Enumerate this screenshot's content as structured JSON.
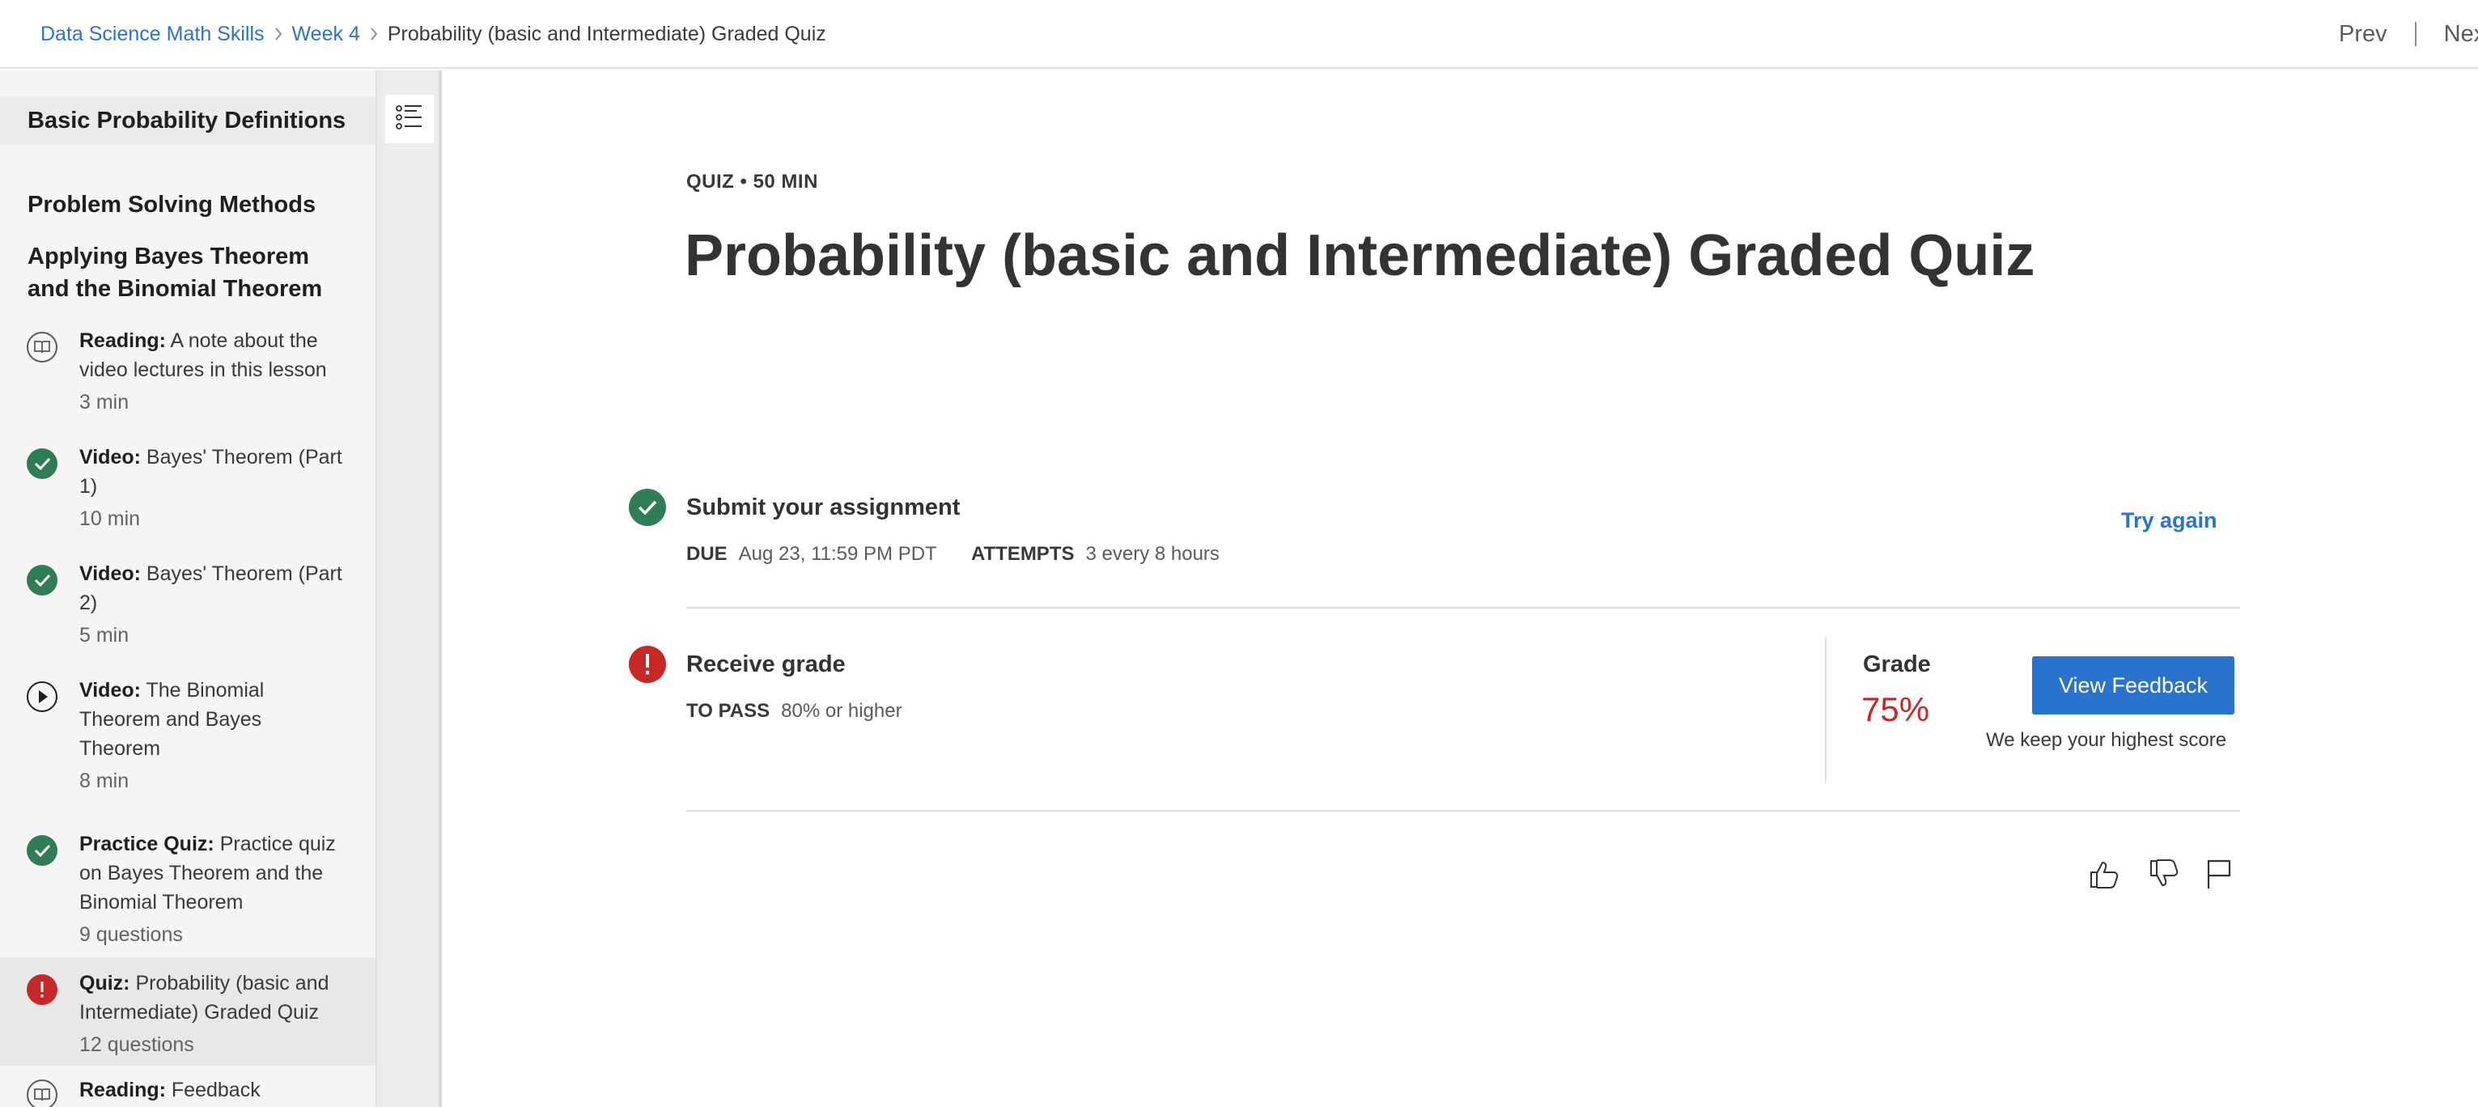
{
  "breadcrumb": {
    "items": [
      "Data Science Math Skills",
      "Week 4"
    ],
    "current": "Probability (basic and Intermediate) Graded Quiz"
  },
  "nav": {
    "prev": "Prev",
    "next": "Next"
  },
  "sidebar": {
    "sections": [
      "Basic Probability Definitions",
      "Problem Solving Methods",
      "Applying Bayes Theorem and the Binomial Theorem"
    ],
    "items": [
      {
        "type": "Reading:",
        "title": "A note about the video lectures in this lesson",
        "meta": "3 min",
        "status": "book-icon"
      },
      {
        "type": "Video:",
        "title": "Bayes' Theorem (Part 1)",
        "meta": "10 min",
        "status": "check-circle-icon"
      },
      {
        "type": "Video:",
        "title": "Bayes' Theorem (Part 2)",
        "meta": "5 min",
        "status": "check-circle-icon"
      },
      {
        "type": "Video:",
        "title": "The Binomial Theorem and Bayes Theorem",
        "meta": "8 min",
        "status": "play-circle-icon"
      },
      {
        "type": "Practice Quiz:",
        "title": "Practice quiz on Bayes Theorem and the Binomial Theorem",
        "meta": "9 questions",
        "status": "check-circle-icon"
      },
      {
        "type": "Quiz:",
        "title": "Probability (basic and Intermediate) Graded Quiz",
        "meta": "12 questions",
        "status": "alert-circle-icon"
      },
      {
        "type": "Reading:",
        "title": "Feedback",
        "meta": "",
        "status": "book-icon"
      }
    ]
  },
  "main": {
    "kicker": "QUIZ • 50 MIN",
    "title": "Probability (basic and Intermediate) Graded Quiz",
    "submit": {
      "title": "Submit your assignment",
      "due_label": "DUE",
      "due_value": "Aug 23, 11:59 PM PDT",
      "attempts_label": "ATTEMPTS",
      "attempts_value": "3 every 8 hours",
      "try_again": "Try again"
    },
    "receive": {
      "title": "Receive grade",
      "pass_label": "TO PASS",
      "pass_value": "80% or higher",
      "grade_label": "Grade",
      "grade_value": "75%",
      "view_feedback": "View Feedback",
      "keep_note": "We keep your highest score"
    }
  },
  "colors": {
    "link": "#2a73cc",
    "success": "#2e7d55",
    "error": "#c62828",
    "button": "#2a73cc"
  }
}
